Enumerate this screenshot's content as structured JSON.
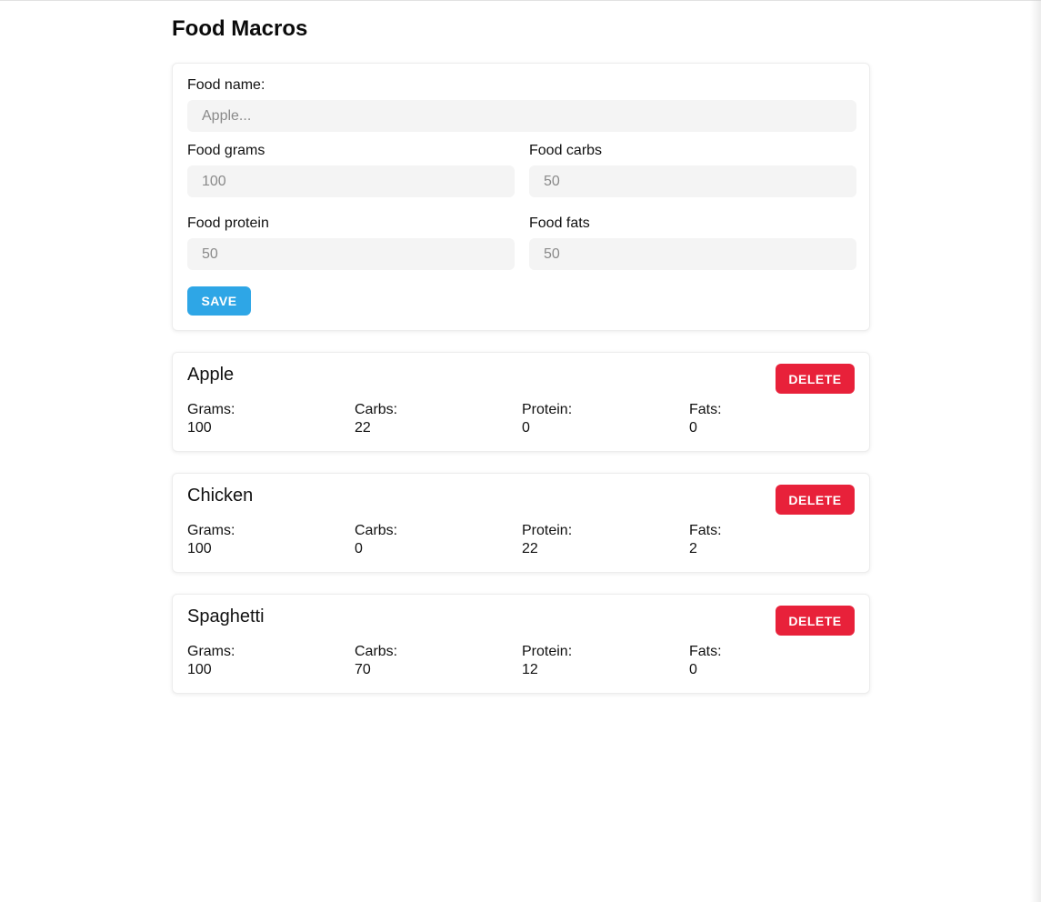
{
  "app": {
    "title": "Food Macros"
  },
  "form": {
    "name_label": "Food name:",
    "name_placeholder": "Apple...",
    "grams_label": "Food grams",
    "grams_placeholder": "100",
    "carbs_label": "Food carbs",
    "carbs_placeholder": "50",
    "protein_label": "Food protein",
    "protein_placeholder": "50",
    "fats_label": "Food fats",
    "fats_placeholder": "50",
    "save_label": "SAVE"
  },
  "foods": [
    {
      "name": "Apple",
      "delete_label": "DELETE",
      "macros": [
        {
          "label": "Grams:",
          "value": "100"
        },
        {
          "label": "Carbs:",
          "value": "22"
        },
        {
          "label": "Protein:",
          "value": "0"
        },
        {
          "label": "Fats:",
          "value": "0"
        }
      ]
    },
    {
      "name": "Chicken",
      "delete_label": "DELETE",
      "macros": [
        {
          "label": "Grams:",
          "value": "100"
        },
        {
          "label": "Carbs:",
          "value": "0"
        },
        {
          "label": "Protein:",
          "value": "22"
        },
        {
          "label": "Fats:",
          "value": "2"
        }
      ]
    },
    {
      "name": "Spaghetti",
      "delete_label": "DELETE",
      "macros": [
        {
          "label": "Grams:",
          "value": "100"
        },
        {
          "label": "Carbs:",
          "value": "70"
        },
        {
          "label": "Protein:",
          "value": "12"
        },
        {
          "label": "Fats:",
          "value": "0"
        }
      ]
    }
  ],
  "colors": {
    "save_button": "#2ea6e6",
    "delete_button": "#e8213a",
    "input_background": "#f4f4f4"
  }
}
